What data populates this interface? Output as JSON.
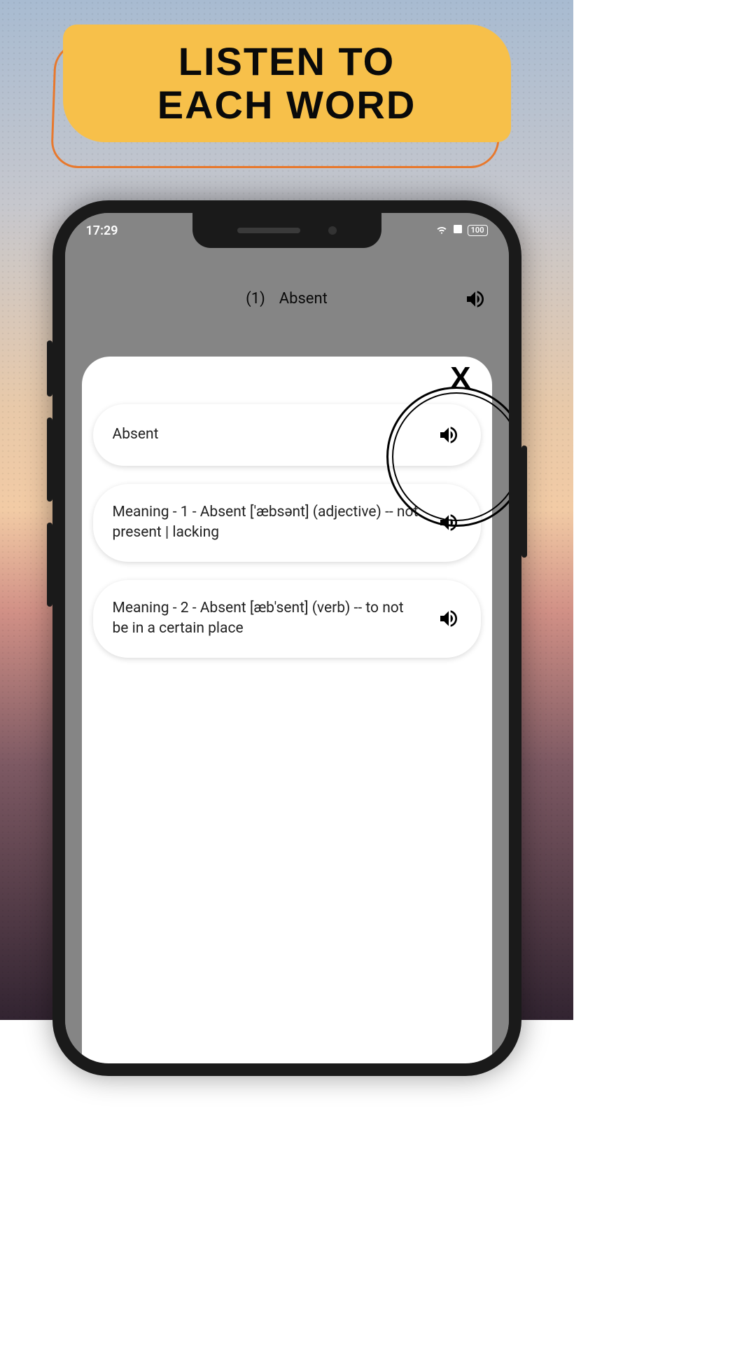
{
  "banner": {
    "line1": "LISTEN TO",
    "line2": "EACH WORD"
  },
  "statusbar": {
    "time": "17:29",
    "battery": "100"
  },
  "background_header": {
    "index": "(1)",
    "word": "Absent"
  },
  "modal": {
    "close": "X",
    "cards": [
      {
        "text": "Absent"
      },
      {
        "text": "Meaning - 1 -  Absent ['æbsənt] (adjective) -- not present | lacking"
      },
      {
        "text": "Meaning - 2 -  Absent [æb'sent] (verb) -- to not be in a certain place"
      }
    ]
  }
}
